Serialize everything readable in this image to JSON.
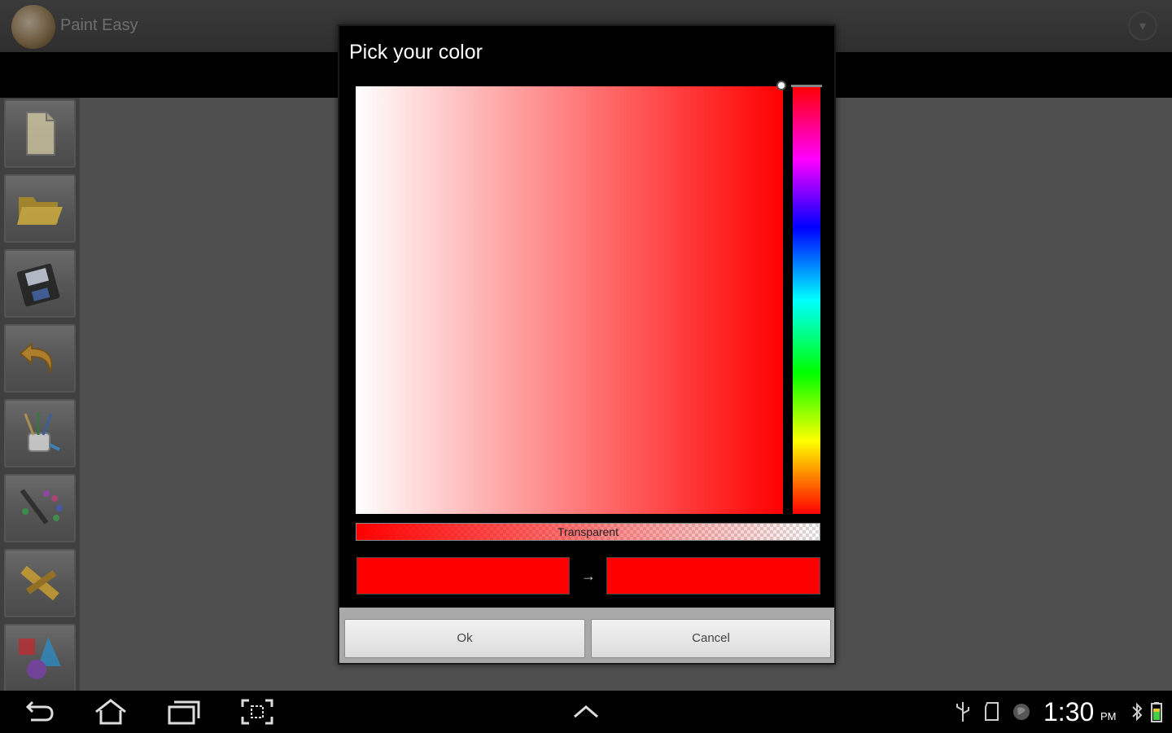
{
  "app": {
    "title": "Paint Easy",
    "overflow_icon": "chevron-down-icon"
  },
  "tools": [
    {
      "name": "new-file-icon"
    },
    {
      "name": "open-folder-icon"
    },
    {
      "name": "save-disk-icon"
    },
    {
      "name": "undo-icon"
    },
    {
      "name": "brushes-cup-icon"
    },
    {
      "name": "pencil-palette-icon"
    },
    {
      "name": "ruler-tool-icon"
    },
    {
      "name": "shapes-3d-icon"
    }
  ],
  "dialog": {
    "title": "Pick your color",
    "transparency_label": "Transparent",
    "old_color": "#ff0000",
    "new_color": "#ff0000",
    "arrow": "→",
    "ok_label": "Ok",
    "cancel_label": "Cancel"
  },
  "system_bar": {
    "time": "1:30",
    "ampm": "PM",
    "nav_icons": [
      "back-icon",
      "home-icon",
      "recent-apps-icon",
      "screenshot-icon",
      "up-caret-icon"
    ],
    "status_icons": [
      "usb-icon",
      "sd-card-icon",
      "globe-icon",
      "bluetooth-icon",
      "battery-icon"
    ]
  },
  "colors": {
    "accent_red": "#ff0000",
    "dialog_bg": "#000000",
    "backdrop": "#4d4d4d"
  }
}
